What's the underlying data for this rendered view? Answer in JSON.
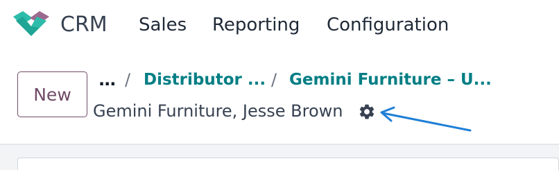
{
  "app": {
    "name": "CRM",
    "logo_icon": "crm-logo-icon"
  },
  "menu": {
    "items": [
      "Sales",
      "Reporting",
      "Configuration"
    ]
  },
  "control_panel": {
    "new_label": "New",
    "breadcrumb": {
      "overflow": "...",
      "separator": "/",
      "items": [
        "Distributor ...",
        "Gemini Furniture – U..."
      ]
    },
    "record_title": "Gemini Furniture, Jesse Brown",
    "settings_icon": "gear-icon"
  },
  "colors": {
    "brand": "#714b67",
    "link": "#017e84",
    "annotation_arrow": "#1f7fd6"
  }
}
